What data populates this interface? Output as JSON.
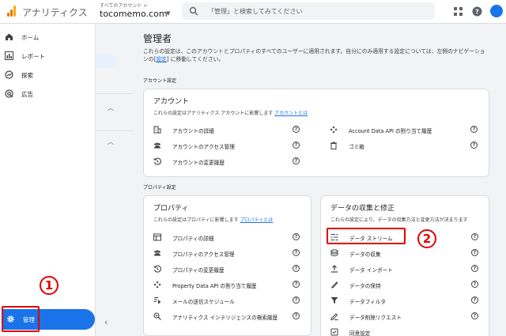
{
  "header": {
    "app_name": "アナリティクス",
    "account_label": "すべてのアカウント >",
    "account_name": "tocomemo.com",
    "search_placeholder": "「管理」と検索してみてください",
    "logo_colors": [
      "#f9ab00",
      "#e37400",
      "#e37400"
    ]
  },
  "sidebar": {
    "items": [
      {
        "label": "ホーム",
        "icon": "home-icon"
      },
      {
        "label": "レポート",
        "icon": "bar-chart-icon"
      },
      {
        "label": "探索",
        "icon": "explore-icon"
      },
      {
        "label": "広告",
        "icon": "ads-icon"
      }
    ],
    "admin": {
      "label": "管理",
      "icon": "gear-icon",
      "active": true
    },
    "accent": "#1a73e8"
  },
  "main": {
    "title": "管理者",
    "desc_1": "これらの設定は、このアカウントとプロパティのすべてのユーザーに適用されます。自分にのみ適用する設定については、左側のナビゲーションの[",
    "desc_link": "設定",
    "desc_2": "] に移動してください。",
    "account_section": "アカウント設定",
    "property_section": "プロパティ設定"
  },
  "account_card": {
    "title": "アカウント",
    "desc": "これらの設定はアナリティクス アカウントに影響します",
    "desc_link": "アカウントとは",
    "left": [
      {
        "label": "アカウントの詳細",
        "icon": "building-icon"
      },
      {
        "label": "アカウントのアクセス管理",
        "icon": "people-icon"
      },
      {
        "label": "アカウントの変更履歴",
        "icon": "history-icon"
      }
    ],
    "right": [
      {
        "label": "Account Data API の割り当て履歴",
        "icon": "api-icon"
      },
      {
        "label": "ゴミ箱",
        "icon": "trash-icon"
      }
    ]
  },
  "property_card": {
    "title": "プロパティ",
    "desc": "これらの設定はプロパティに影響します",
    "desc_link": "プロパティとは",
    "items": [
      {
        "label": "プロパティの詳細",
        "icon": "property-icon"
      },
      {
        "label": "プロパティのアクセス管理",
        "icon": "people-icon"
      },
      {
        "label": "プロパティの変更履歴",
        "icon": "history-icon"
      },
      {
        "label": "Property Data API の割り当て履歴",
        "icon": "api-icon"
      },
      {
        "label": "メールの送信スケジュール",
        "icon": "schedule-icon"
      },
      {
        "label": "アナリティクス インテリジェンスの検索履歴",
        "icon": "intelligence-icon"
      }
    ]
  },
  "data_card": {
    "title": "データの収集と修正",
    "desc": "これらの設定により、データの収集方法と変更方法が決まります",
    "items": [
      {
        "label": "データ ストリーム",
        "icon": "stream-icon"
      },
      {
        "label": "データの収集",
        "icon": "collection-icon"
      },
      {
        "label": "データ インポート",
        "icon": "import-icon"
      },
      {
        "label": "データの保持",
        "icon": "retention-icon"
      },
      {
        "label": "データフィルタ",
        "icon": "filter-icon"
      },
      {
        "label": "データ削除リクエスト",
        "icon": "delete-request-icon"
      },
      {
        "label": "同意設定",
        "icon": "consent-icon"
      }
    ]
  },
  "annotations": {
    "one": "1",
    "two": "2",
    "color": "#e00000"
  }
}
